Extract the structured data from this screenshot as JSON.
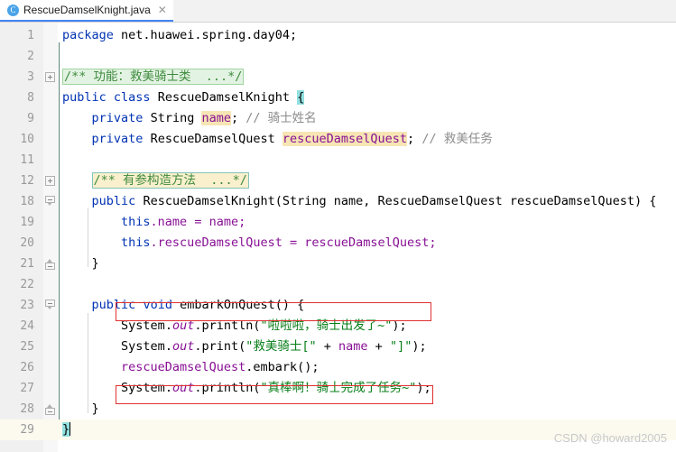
{
  "window": {
    "app": "Java IDE Editor"
  },
  "tab": {
    "icon": "java-class-icon",
    "icon_glyph": "C",
    "label": "RescueDamselKnight.java",
    "close_glyph": "✕"
  },
  "editor": {
    "language": "java",
    "current_line": 29,
    "line_numbers": [
      1,
      2,
      3,
      8,
      9,
      10,
      11,
      12,
      18,
      19,
      20,
      21,
      22,
      23,
      24,
      25,
      26,
      27,
      28,
      29
    ],
    "code_lines": [
      "package net.huawei.spring.day04;",
      "",
      "/** 功能：救美骑士类  ...*/",
      "public class RescueDamselKnight {",
      "    private String name; // 骑士姓名",
      "    private RescueDamselQuest rescueDamselQuest; // 救美任务",
      "",
      "    /** 有参构造方法  ...*/",
      "    public RescueDamselKnight(String name, RescueDamselQuest rescueDamselQuest) {",
      "        this.name = name;",
      "        this.rescueDamselQuest = rescueDamselQuest;",
      "    }",
      "",
      "    public void embarkOnQuest() {",
      "        System.out.println(\"啦啦啦，骑士出发了~\");",
      "        System.out.print(\"救美骑士[\" + name + \"]\");",
      "        rescueDamselQuest.embark();",
      "        System.out.println(\"真棒啊！骑士完成了任务~\");",
      "    }",
      "}"
    ],
    "tokens": {
      "kw_package": "package",
      "pkg_name": "net.huawei.spring.day04;",
      "fold_comment_class": "/** 功能：救美骑士类  ...*/",
      "kw_public": "public",
      "kw_class": "class",
      "class_name": "RescueDamselKnight",
      "brace_open": "{",
      "kw_private": "private",
      "type_string": "String",
      "field_name": "name",
      "semi": ";",
      "comment_name": "// 骑士姓名",
      "type_quest": "RescueDamselQuest",
      "field_quest": "rescueDamselQuest",
      "comment_quest": "// 救美任务",
      "fold_comment_ctor": "/** 有参构造方法  ...*/",
      "ctor_sig": "RescueDamselKnight(String name, RescueDamselQuest rescueDamselQuest) {",
      "kw_this": "this",
      "assign_name": ".name = name;",
      "assign_quest": ".rescueDamselQuest = rescueDamselQuest;",
      "brace_close": "}",
      "kw_void": "void",
      "method_name": "embarkOnQuest() {",
      "system": "System",
      "out": "out",
      "println": ".println(",
      "print": ".print(",
      "str_depart": "\"啦啦啦，骑士出发了~\"",
      "str_knight_open": "\"救美骑士[\"",
      "str_bracket_close": "\"]\"",
      "plus": " + ",
      "var_name": "name",
      "embark_call": ".embark();",
      "str_done": "\"真棒啊！骑士完成了任务~\"",
      "close_paren_semi": ");",
      "dot": "."
    },
    "fold_markers": [
      {
        "line": 3,
        "type": "plus"
      },
      {
        "line": 12,
        "type": "plus"
      },
      {
        "line": 18,
        "type": "collapse-down"
      },
      {
        "line": 21,
        "type": "collapse-up"
      },
      {
        "line": 23,
        "type": "collapse-down"
      },
      {
        "line": 28,
        "type": "collapse-up"
      }
    ],
    "annotations": [
      {
        "name": "redbox-line-24",
        "line": 24
      },
      {
        "name": "redbox-line-27",
        "line": 27
      }
    ]
  },
  "colors": {
    "keyword": "#0033b3",
    "string": "#067d17",
    "comment": "#8c8c8c",
    "doc_comment": "#3d8a3d",
    "field": "#871094",
    "tab_accent": "#4285f4",
    "annotation_box": "#e03030",
    "current_line_bg": "#fcfaef",
    "identifier_highlight": "#f7e5b4",
    "brace_highlight": "#93e0e0"
  },
  "watermark": {
    "text": "CSDN @howard2005"
  }
}
